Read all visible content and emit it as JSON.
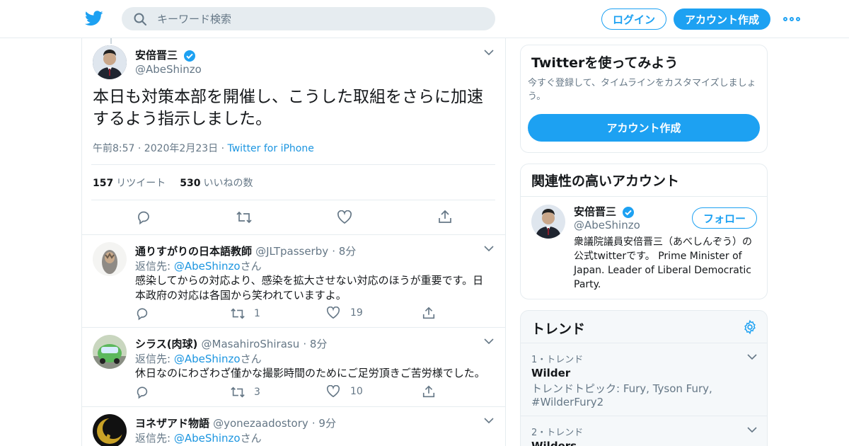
{
  "header": {
    "search_placeholder": "キーワード検索",
    "login_label": "ログイン",
    "signup_label": "アカウント作成"
  },
  "tweet": {
    "name": "安倍晋三",
    "handle": "@AbeShinzo",
    "text": "本日も対策本部を開催し、こうした取組をさらに加速するよう指示しました。",
    "time": "午前8:57 · 2020年2月23日",
    "sep": "·",
    "source": "Twitter for iPhone",
    "retweets": "157",
    "retweets_label": "リツイート",
    "likes": "530",
    "likes_label": "いいねの数"
  },
  "replies": [
    {
      "name": "通りすがりの日本語教師",
      "handle": "@JLTpasserby",
      "time": "· 8分",
      "reply_prefix": "返信先:",
      "reply_to": "@AbeShinzo",
      "reply_suffix": "さん",
      "text": "感染してからの対応より、感染を拡大させない対応のほうが重要です。日本政府の対応は各国から笑われていますよ。",
      "retweets": "1",
      "likes": "19"
    },
    {
      "name": "シラス(肉球)",
      "handle": "@MasahiroShirasu",
      "time": "· 8分",
      "reply_prefix": "返信先:",
      "reply_to": "@AbeShinzo",
      "reply_suffix": "さん",
      "text": "休日なのにわざわざ僅かな撮影時間のためにご足労頂きご苦労様でした。",
      "retweets": "3",
      "likes": "10"
    },
    {
      "name": "ヨネザアド物語",
      "handle": "@yonezaadostory",
      "time": "· 9分",
      "reply_prefix": "返信先:",
      "reply_to": "@AbeShinzo",
      "reply_suffix": "さん"
    }
  ],
  "signup_card": {
    "title": "Twitterを使ってみよう",
    "desc": "今すぐ登録して、タイムラインをカスタマイズしましょう。",
    "button": "アカウント作成"
  },
  "related": {
    "title": "関連性の高いアカウント",
    "name": "安倍晋三",
    "handle": "@AbeShinzo",
    "follow": "フォロー",
    "bio": "衆議院議員安倍晋三（あべしんぞう）の公式twitterです。 Prime Minister of Japan. Leader of Liberal Democratic Party."
  },
  "trends": {
    "title": "トレンド",
    "items": [
      {
        "category": "1・トレンド",
        "name": "Wilder",
        "desc": "トレンドトピック: Fury, Tyson Fury, #WilderFury2"
      },
      {
        "category": "2・トレンド",
        "name": "Wilders"
      }
    ]
  },
  "colors": {
    "accent": "#1da1f2",
    "link": "#1b95e0",
    "muted": "#657786",
    "border": "#e6ecf0"
  }
}
